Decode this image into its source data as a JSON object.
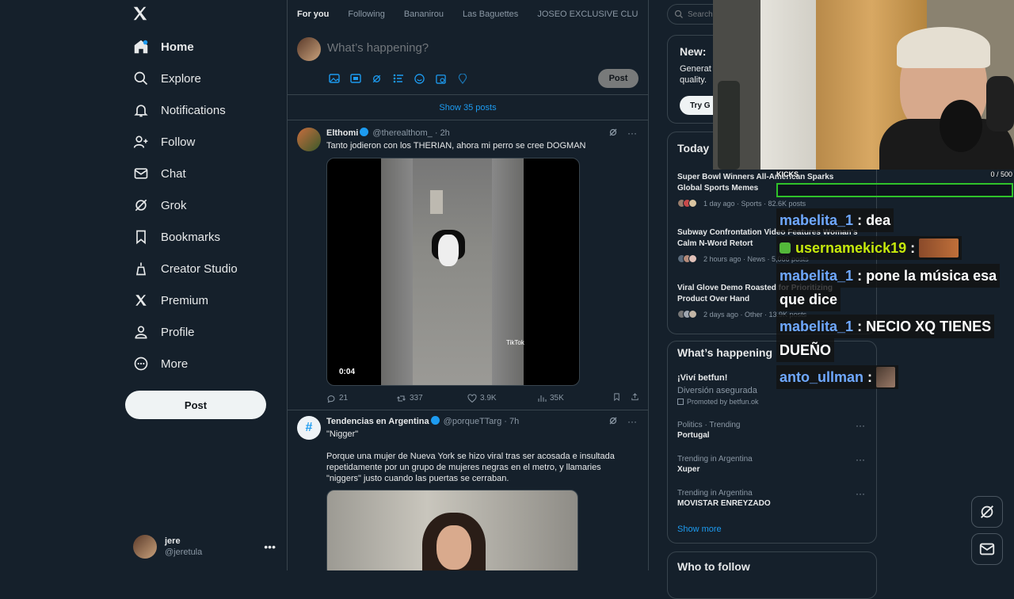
{
  "nav": {
    "items": [
      {
        "label": "Home",
        "icon": "home-icon"
      },
      {
        "label": "Explore",
        "icon": "search-icon"
      },
      {
        "label": "Notifications",
        "icon": "bell-icon"
      },
      {
        "label": "Follow",
        "icon": "follow-icon"
      },
      {
        "label": "Chat",
        "icon": "mail-icon"
      },
      {
        "label": "Grok",
        "icon": "grok-icon"
      },
      {
        "label": "Bookmarks",
        "icon": "bookmark-icon"
      },
      {
        "label": "Creator Studio",
        "icon": "creator-icon"
      },
      {
        "label": "Premium",
        "icon": "x-icon"
      },
      {
        "label": "Profile",
        "icon": "person-icon"
      },
      {
        "label": "More",
        "icon": "more-icon"
      }
    ],
    "post_label": "Post",
    "account": {
      "name": "jere",
      "handle": "@jeretula"
    }
  },
  "tabs": [
    "For you",
    "Following",
    "Bananirou",
    "Las Baguettes",
    "JOSEO EXCLUSIVE CLU"
  ],
  "composer": {
    "placeholder": "What’s happening?",
    "post_label": "Post"
  },
  "show_posts": "Show 35 posts",
  "tweets": [
    {
      "name": "Elthomi",
      "handle": "@therealthom_",
      "time": "· 2h",
      "text": "Tanto jodieron con los THERIAN, ahora mi perro se cree DOGMAN",
      "duration": "0:04",
      "watermark": "TikTok",
      "replies": "21",
      "retweets": "337",
      "likes": "3.9K",
      "views": "35K"
    },
    {
      "name": "Tendencias en Argentina",
      "handle": "@porqueTTarg",
      "time": "· 7h",
      "quote": "\"Nigger\"",
      "text": "Porque una mujer de Nueva York se hizo viral tras ser acosada e insultada repetidamente por un grupo de mujeres negras en el metro, y llamaries \"niggers\" justo cuando las puertas se cerraban."
    }
  ],
  "right": {
    "search_placeholder": "Search",
    "premium": {
      "title": "New:",
      "text1": "Generat",
      "text2": "quality.",
      "btn": "Try G"
    },
    "today_title": "Today",
    "news": [
      {
        "title": "Super Bowl Winners All-American Sparks Global Sports Memes",
        "meta": "1 day ago · Sports · 82.6K posts"
      },
      {
        "title": "Subway Confrontation Video Features Woman's Calm N-Word Retort",
        "meta": "2 hours ago · News · 5,066 posts"
      },
      {
        "title": "Viral Glove Demo Roasted for Prioritizing Product Over Hand",
        "meta": "2 days ago · Other · 13.9K posts"
      }
    ],
    "whats_title": "What’s happening",
    "promo": {
      "title": "¡Viví betfun!",
      "sub": "Diversión asegurada",
      "by": "Promoted by betfun.ok"
    },
    "trends": [
      {
        "ctx": "Politics · Trending",
        "title": "Portugal"
      },
      {
        "ctx": "Trending in Argentina",
        "title": "Xuper"
      },
      {
        "ctx": "Trending in Argentina",
        "title": "MOVISTAR ENREYZADO"
      }
    ],
    "show_more": "Show more",
    "who_title": "Who to follow"
  },
  "overlay": {
    "kicks_label": "KICKS",
    "kicks_count": "0 / 500",
    "chat": [
      {
        "user": "mabelita_1",
        "msg": "dea"
      },
      {
        "user": "usernamekick19",
        "msg": ""
      },
      {
        "user": "mabelita_1",
        "msg": "pone la música esa",
        "cont": "que dice"
      },
      {
        "user": "mabelita_1",
        "msg": "NECIO XQ TIENES",
        "cont": "DUEÑO"
      },
      {
        "user": "anto_ullman",
        "msg": ""
      }
    ]
  }
}
